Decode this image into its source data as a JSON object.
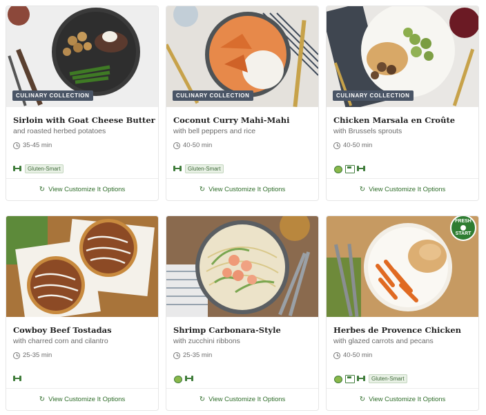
{
  "footer_label": "View Customize It Options",
  "colors": {
    "accent": "#2f6d2a",
    "badge": "#4a5566",
    "tag_bg": "#e9f1e6"
  },
  "cards": [
    {
      "title": "Sirloin with Goat Cheese Butter",
      "subtitle": "and roasted herbed potatoes",
      "time": "35-45 min",
      "badge": "CULINARY COLLECTION",
      "icons": [
        "dumbbell-icon"
      ],
      "pill": "Gluten-Smart"
    },
    {
      "title": "Coconut Curry Mahi-Mahi",
      "subtitle": "with bell peppers and rice",
      "time": "40-50 min",
      "badge": "CULINARY COLLECTION",
      "icons": [
        "dumbbell-icon"
      ],
      "pill": "Gluten-Smart"
    },
    {
      "title": "Chicken Marsala en Croûte",
      "subtitle": "with Brussels sprouts",
      "time": "40-50 min",
      "badge": "CULINARY COLLECTION",
      "icons": [
        "apple-icon",
        "scale-icon",
        "dumbbell-icon"
      ],
      "pill": ""
    },
    {
      "title": "Cowboy Beef Tostadas",
      "subtitle": "with charred corn and cilantro",
      "time": "25-35 min",
      "badge": "",
      "icons": [
        "dumbbell-icon"
      ],
      "pill": ""
    },
    {
      "title": "Shrimp Carbonara-Style",
      "subtitle": "with zucchini ribbons",
      "time": "25-35 min",
      "badge": "",
      "icons": [
        "apple-icon",
        "dumbbell-icon"
      ],
      "pill": ""
    },
    {
      "title": "Herbes de Provence Chicken",
      "subtitle": "with glazed carrots and pecans",
      "time": "40-50 min",
      "badge": "",
      "fresh_start": [
        "FRESH",
        "START"
      ],
      "icons": [
        "apple-icon",
        "scale-icon",
        "dumbbell-icon"
      ],
      "pill": "Gluten-Smart"
    }
  ]
}
